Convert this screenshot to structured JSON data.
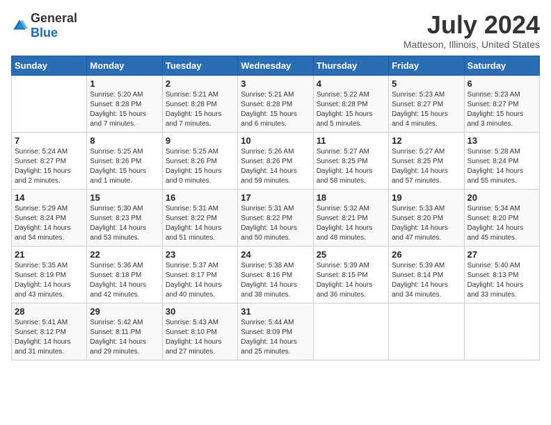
{
  "logo": {
    "general": "General",
    "blue": "Blue"
  },
  "title": "July 2024",
  "subtitle": "Matteson, Illinois, United States",
  "weekdays": [
    "Sunday",
    "Monday",
    "Tuesday",
    "Wednesday",
    "Thursday",
    "Friday",
    "Saturday"
  ],
  "weeks": [
    [
      {
        "day": "",
        "sunrise": "",
        "sunset": "",
        "daylight": ""
      },
      {
        "day": "1",
        "sunrise": "Sunrise: 5:20 AM",
        "sunset": "Sunset: 8:28 PM",
        "daylight": "Daylight: 15 hours and 7 minutes."
      },
      {
        "day": "2",
        "sunrise": "Sunrise: 5:21 AM",
        "sunset": "Sunset: 8:28 PM",
        "daylight": "Daylight: 15 hours and 7 minutes."
      },
      {
        "day": "3",
        "sunrise": "Sunrise: 5:21 AM",
        "sunset": "Sunset: 8:28 PM",
        "daylight": "Daylight: 15 hours and 6 minutes."
      },
      {
        "day": "4",
        "sunrise": "Sunrise: 5:22 AM",
        "sunset": "Sunset: 8:28 PM",
        "daylight": "Daylight: 15 hours and 5 minutes."
      },
      {
        "day": "5",
        "sunrise": "Sunrise: 5:23 AM",
        "sunset": "Sunset: 8:27 PM",
        "daylight": "Daylight: 15 hours and 4 minutes."
      },
      {
        "day": "6",
        "sunrise": "Sunrise: 5:23 AM",
        "sunset": "Sunset: 8:27 PM",
        "daylight": "Daylight: 15 hours and 3 minutes."
      }
    ],
    [
      {
        "day": "7",
        "sunrise": "Sunrise: 5:24 AM",
        "sunset": "Sunset: 8:27 PM",
        "daylight": "Daylight: 15 hours and 2 minutes."
      },
      {
        "day": "8",
        "sunrise": "Sunrise: 5:25 AM",
        "sunset": "Sunset: 8:26 PM",
        "daylight": "Daylight: 15 hours and 1 minute."
      },
      {
        "day": "9",
        "sunrise": "Sunrise: 5:25 AM",
        "sunset": "Sunset: 8:26 PM",
        "daylight": "Daylight: 15 hours and 0 minutes."
      },
      {
        "day": "10",
        "sunrise": "Sunrise: 5:26 AM",
        "sunset": "Sunset: 8:26 PM",
        "daylight": "Daylight: 14 hours and 59 minutes."
      },
      {
        "day": "11",
        "sunrise": "Sunrise: 5:27 AM",
        "sunset": "Sunset: 8:25 PM",
        "daylight": "Daylight: 14 hours and 58 minutes."
      },
      {
        "day": "12",
        "sunrise": "Sunrise: 5:27 AM",
        "sunset": "Sunset: 8:25 PM",
        "daylight": "Daylight: 14 hours and 57 minutes."
      },
      {
        "day": "13",
        "sunrise": "Sunrise: 5:28 AM",
        "sunset": "Sunset: 8:24 PM",
        "daylight": "Daylight: 14 hours and 55 minutes."
      }
    ],
    [
      {
        "day": "14",
        "sunrise": "Sunrise: 5:29 AM",
        "sunset": "Sunset: 8:24 PM",
        "daylight": "Daylight: 14 hours and 54 minutes."
      },
      {
        "day": "15",
        "sunrise": "Sunrise: 5:30 AM",
        "sunset": "Sunset: 8:23 PM",
        "daylight": "Daylight: 14 hours and 53 minutes."
      },
      {
        "day": "16",
        "sunrise": "Sunrise: 5:31 AM",
        "sunset": "Sunset: 8:22 PM",
        "daylight": "Daylight: 14 hours and 51 minutes."
      },
      {
        "day": "17",
        "sunrise": "Sunrise: 5:31 AM",
        "sunset": "Sunset: 8:22 PM",
        "daylight": "Daylight: 14 hours and 50 minutes."
      },
      {
        "day": "18",
        "sunrise": "Sunrise: 5:32 AM",
        "sunset": "Sunset: 8:21 PM",
        "daylight": "Daylight: 14 hours and 48 minutes."
      },
      {
        "day": "19",
        "sunrise": "Sunrise: 5:33 AM",
        "sunset": "Sunset: 8:20 PM",
        "daylight": "Daylight: 14 hours and 47 minutes."
      },
      {
        "day": "20",
        "sunrise": "Sunrise: 5:34 AM",
        "sunset": "Sunset: 8:20 PM",
        "daylight": "Daylight: 14 hours and 45 minutes."
      }
    ],
    [
      {
        "day": "21",
        "sunrise": "Sunrise: 5:35 AM",
        "sunset": "Sunset: 8:19 PM",
        "daylight": "Daylight: 14 hours and 43 minutes."
      },
      {
        "day": "22",
        "sunrise": "Sunrise: 5:36 AM",
        "sunset": "Sunset: 8:18 PM",
        "daylight": "Daylight: 14 hours and 42 minutes."
      },
      {
        "day": "23",
        "sunrise": "Sunrise: 5:37 AM",
        "sunset": "Sunset: 8:17 PM",
        "daylight": "Daylight: 14 hours and 40 minutes."
      },
      {
        "day": "24",
        "sunrise": "Sunrise: 5:38 AM",
        "sunset": "Sunset: 8:16 PM",
        "daylight": "Daylight: 14 hours and 38 minutes."
      },
      {
        "day": "25",
        "sunrise": "Sunrise: 5:39 AM",
        "sunset": "Sunset: 8:15 PM",
        "daylight": "Daylight: 14 hours and 36 minutes."
      },
      {
        "day": "26",
        "sunrise": "Sunrise: 5:39 AM",
        "sunset": "Sunset: 8:14 PM",
        "daylight": "Daylight: 14 hours and 34 minutes."
      },
      {
        "day": "27",
        "sunrise": "Sunrise: 5:40 AM",
        "sunset": "Sunset: 8:13 PM",
        "daylight": "Daylight: 14 hours and 33 minutes."
      }
    ],
    [
      {
        "day": "28",
        "sunrise": "Sunrise: 5:41 AM",
        "sunset": "Sunset: 8:12 PM",
        "daylight": "Daylight: 14 hours and 31 minutes."
      },
      {
        "day": "29",
        "sunrise": "Sunrise: 5:42 AM",
        "sunset": "Sunset: 8:11 PM",
        "daylight": "Daylight: 14 hours and 29 minutes."
      },
      {
        "day": "30",
        "sunrise": "Sunrise: 5:43 AM",
        "sunset": "Sunset: 8:10 PM",
        "daylight": "Daylight: 14 hours and 27 minutes."
      },
      {
        "day": "31",
        "sunrise": "Sunrise: 5:44 AM",
        "sunset": "Sunset: 8:09 PM",
        "daylight": "Daylight: 14 hours and 25 minutes."
      },
      {
        "day": "",
        "sunrise": "",
        "sunset": "",
        "daylight": ""
      },
      {
        "day": "",
        "sunrise": "",
        "sunset": "",
        "daylight": ""
      },
      {
        "day": "",
        "sunrise": "",
        "sunset": "",
        "daylight": ""
      }
    ]
  ]
}
